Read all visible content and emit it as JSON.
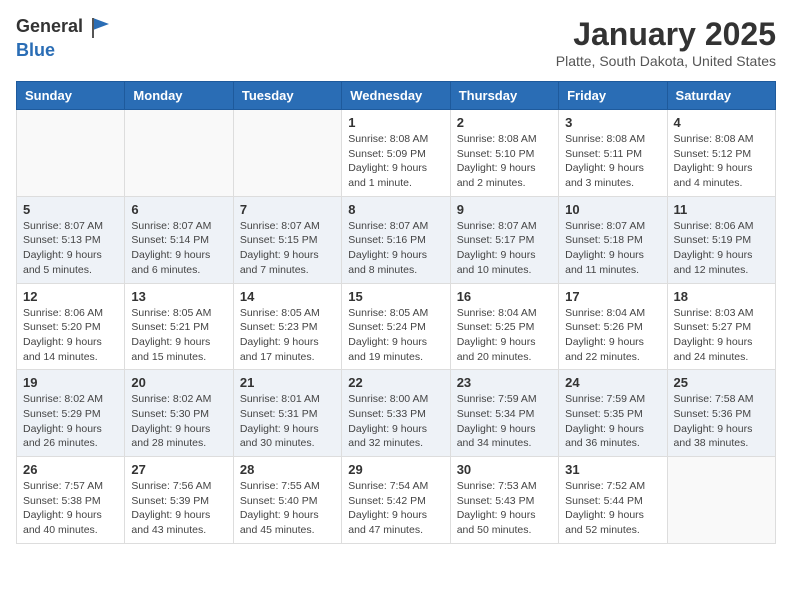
{
  "header": {
    "logo": {
      "general": "General",
      "blue": "Blue"
    },
    "title": "January 2025",
    "location": "Platte, South Dakota, United States"
  },
  "weekdays": [
    "Sunday",
    "Monday",
    "Tuesday",
    "Wednesday",
    "Thursday",
    "Friday",
    "Saturday"
  ],
  "weeks": [
    {
      "shade": false,
      "days": [
        {
          "num": "",
          "info": ""
        },
        {
          "num": "",
          "info": ""
        },
        {
          "num": "",
          "info": ""
        },
        {
          "num": "1",
          "info": "Sunrise: 8:08 AM\nSunset: 5:09 PM\nDaylight: 9 hours and 1 minute."
        },
        {
          "num": "2",
          "info": "Sunrise: 8:08 AM\nSunset: 5:10 PM\nDaylight: 9 hours and 2 minutes."
        },
        {
          "num": "3",
          "info": "Sunrise: 8:08 AM\nSunset: 5:11 PM\nDaylight: 9 hours and 3 minutes."
        },
        {
          "num": "4",
          "info": "Sunrise: 8:08 AM\nSunset: 5:12 PM\nDaylight: 9 hours and 4 minutes."
        }
      ]
    },
    {
      "shade": true,
      "days": [
        {
          "num": "5",
          "info": "Sunrise: 8:07 AM\nSunset: 5:13 PM\nDaylight: 9 hours and 5 minutes."
        },
        {
          "num": "6",
          "info": "Sunrise: 8:07 AM\nSunset: 5:14 PM\nDaylight: 9 hours and 6 minutes."
        },
        {
          "num": "7",
          "info": "Sunrise: 8:07 AM\nSunset: 5:15 PM\nDaylight: 9 hours and 7 minutes."
        },
        {
          "num": "8",
          "info": "Sunrise: 8:07 AM\nSunset: 5:16 PM\nDaylight: 9 hours and 8 minutes."
        },
        {
          "num": "9",
          "info": "Sunrise: 8:07 AM\nSunset: 5:17 PM\nDaylight: 9 hours and 10 minutes."
        },
        {
          "num": "10",
          "info": "Sunrise: 8:07 AM\nSunset: 5:18 PM\nDaylight: 9 hours and 11 minutes."
        },
        {
          "num": "11",
          "info": "Sunrise: 8:06 AM\nSunset: 5:19 PM\nDaylight: 9 hours and 12 minutes."
        }
      ]
    },
    {
      "shade": false,
      "days": [
        {
          "num": "12",
          "info": "Sunrise: 8:06 AM\nSunset: 5:20 PM\nDaylight: 9 hours and 14 minutes."
        },
        {
          "num": "13",
          "info": "Sunrise: 8:05 AM\nSunset: 5:21 PM\nDaylight: 9 hours and 15 minutes."
        },
        {
          "num": "14",
          "info": "Sunrise: 8:05 AM\nSunset: 5:23 PM\nDaylight: 9 hours and 17 minutes."
        },
        {
          "num": "15",
          "info": "Sunrise: 8:05 AM\nSunset: 5:24 PM\nDaylight: 9 hours and 19 minutes."
        },
        {
          "num": "16",
          "info": "Sunrise: 8:04 AM\nSunset: 5:25 PM\nDaylight: 9 hours and 20 minutes."
        },
        {
          "num": "17",
          "info": "Sunrise: 8:04 AM\nSunset: 5:26 PM\nDaylight: 9 hours and 22 minutes."
        },
        {
          "num": "18",
          "info": "Sunrise: 8:03 AM\nSunset: 5:27 PM\nDaylight: 9 hours and 24 minutes."
        }
      ]
    },
    {
      "shade": true,
      "days": [
        {
          "num": "19",
          "info": "Sunrise: 8:02 AM\nSunset: 5:29 PM\nDaylight: 9 hours and 26 minutes."
        },
        {
          "num": "20",
          "info": "Sunrise: 8:02 AM\nSunset: 5:30 PM\nDaylight: 9 hours and 28 minutes."
        },
        {
          "num": "21",
          "info": "Sunrise: 8:01 AM\nSunset: 5:31 PM\nDaylight: 9 hours and 30 minutes."
        },
        {
          "num": "22",
          "info": "Sunrise: 8:00 AM\nSunset: 5:33 PM\nDaylight: 9 hours and 32 minutes."
        },
        {
          "num": "23",
          "info": "Sunrise: 7:59 AM\nSunset: 5:34 PM\nDaylight: 9 hours and 34 minutes."
        },
        {
          "num": "24",
          "info": "Sunrise: 7:59 AM\nSunset: 5:35 PM\nDaylight: 9 hours and 36 minutes."
        },
        {
          "num": "25",
          "info": "Sunrise: 7:58 AM\nSunset: 5:36 PM\nDaylight: 9 hours and 38 minutes."
        }
      ]
    },
    {
      "shade": false,
      "days": [
        {
          "num": "26",
          "info": "Sunrise: 7:57 AM\nSunset: 5:38 PM\nDaylight: 9 hours and 40 minutes."
        },
        {
          "num": "27",
          "info": "Sunrise: 7:56 AM\nSunset: 5:39 PM\nDaylight: 9 hours and 43 minutes."
        },
        {
          "num": "28",
          "info": "Sunrise: 7:55 AM\nSunset: 5:40 PM\nDaylight: 9 hours and 45 minutes."
        },
        {
          "num": "29",
          "info": "Sunrise: 7:54 AM\nSunset: 5:42 PM\nDaylight: 9 hours and 47 minutes."
        },
        {
          "num": "30",
          "info": "Sunrise: 7:53 AM\nSunset: 5:43 PM\nDaylight: 9 hours and 50 minutes."
        },
        {
          "num": "31",
          "info": "Sunrise: 7:52 AM\nSunset: 5:44 PM\nDaylight: 9 hours and 52 minutes."
        },
        {
          "num": "",
          "info": ""
        }
      ]
    }
  ]
}
